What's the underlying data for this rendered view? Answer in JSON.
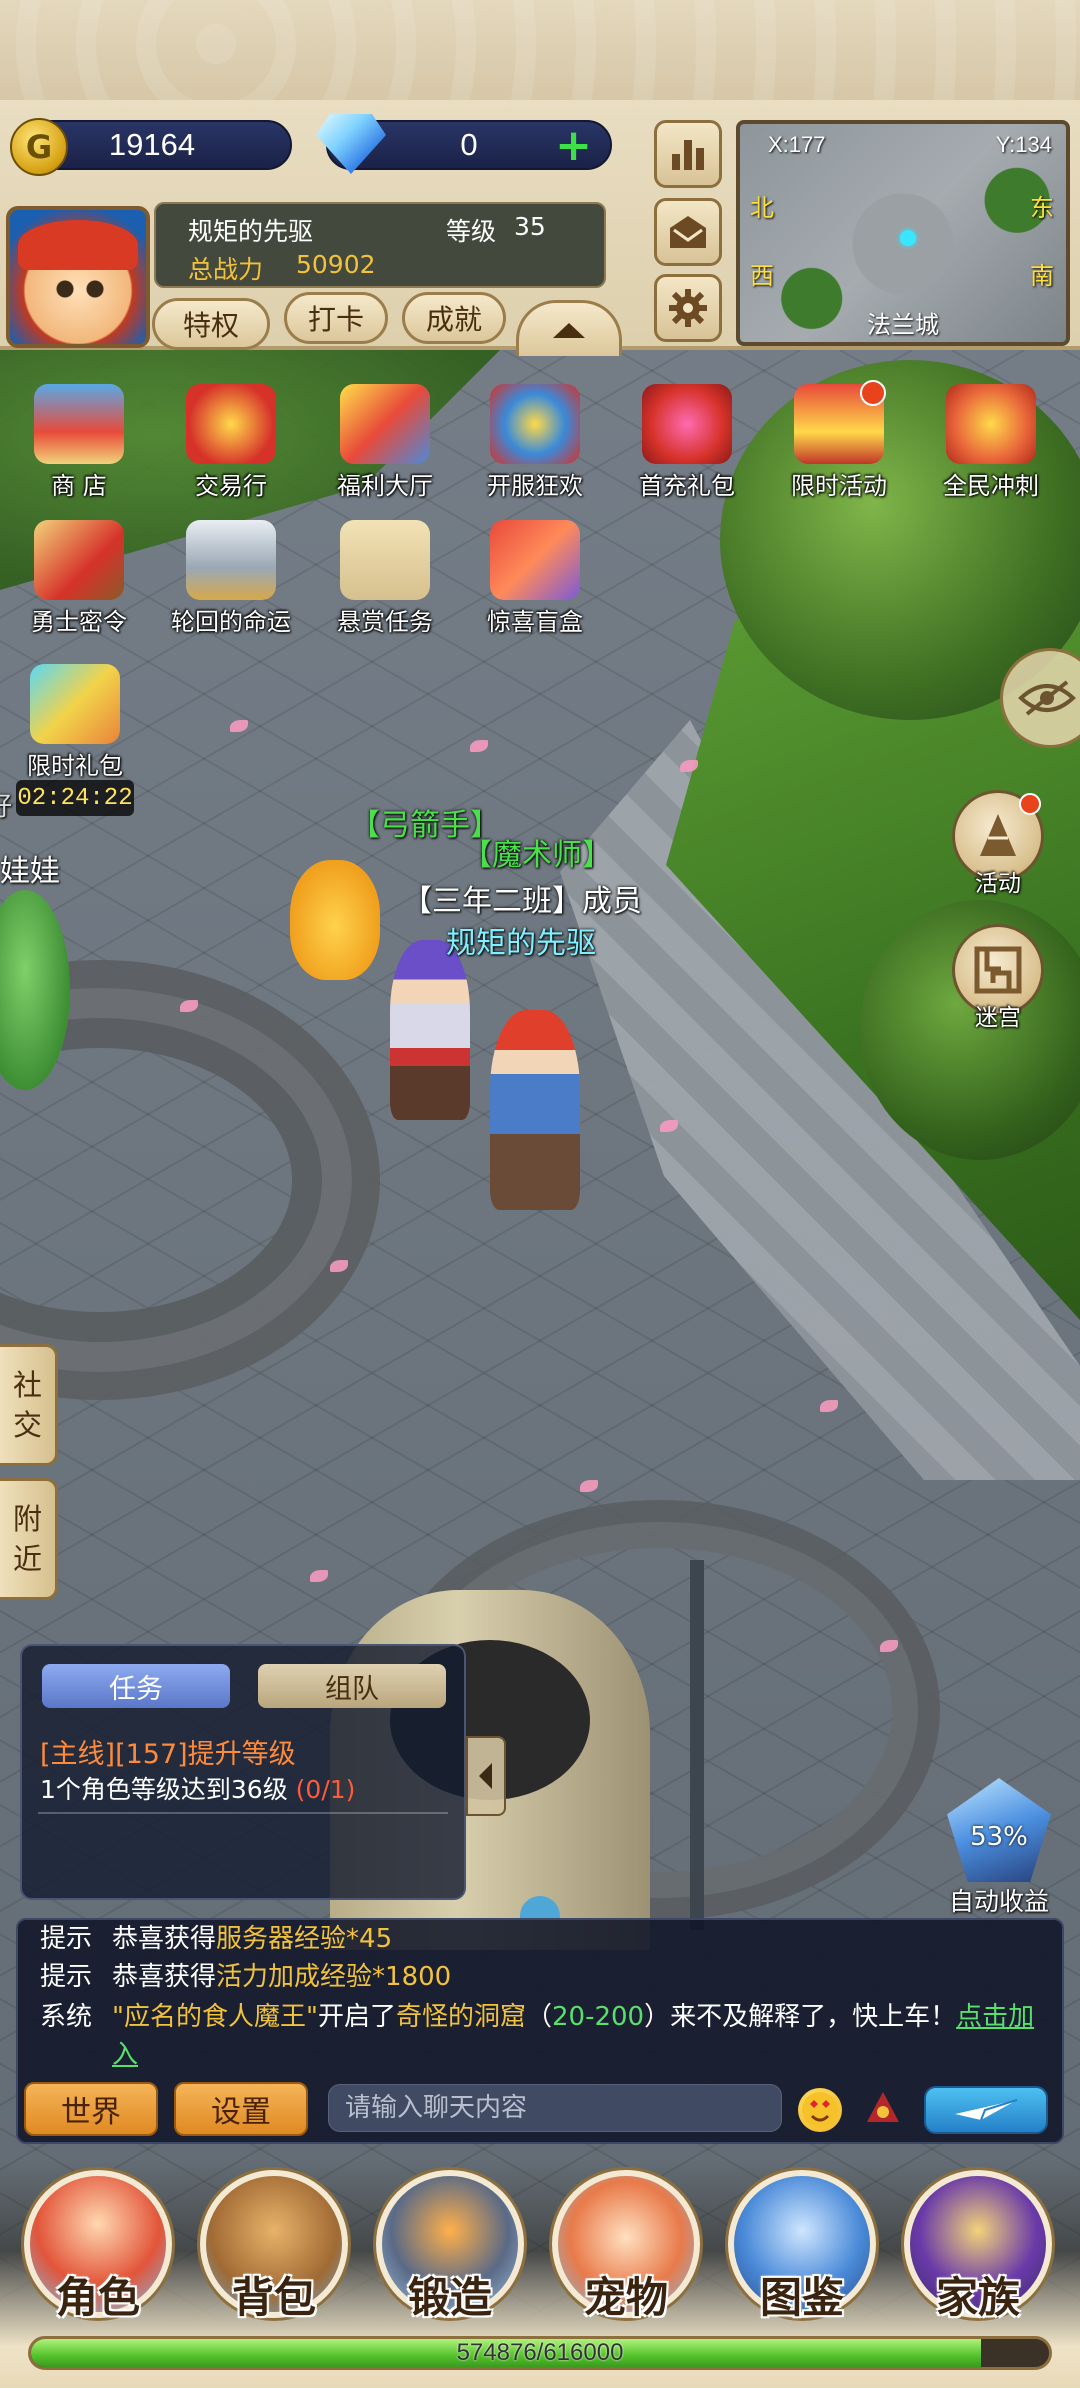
{
  "currency": {
    "gold": "19164",
    "diamond": "0"
  },
  "minimap": {
    "x_label": "X:177",
    "y_label": "Y:134",
    "north": "北",
    "east": "东",
    "west": "西",
    "south": "南",
    "city": "法兰城"
  },
  "player": {
    "name": "规矩的先驱",
    "level_label": "等级",
    "level": "35",
    "power_label": "总战力",
    "power": "50902"
  },
  "top_buttons": {
    "privilege": "特权",
    "checkin": "打卡",
    "achievement": "成就"
  },
  "activities": [
    {
      "label": "商 店",
      "icon": "shop-cart-icon",
      "badge": false
    },
    {
      "label": "交易行",
      "icon": "trade-scale-icon",
      "badge": false
    },
    {
      "label": "福利大厅",
      "icon": "welfare-gift-icon",
      "badge": false
    },
    {
      "label": "开服狂欢",
      "icon": "celebration-icon",
      "badge": false
    },
    {
      "label": "首充礼包",
      "icon": "first-recharge-icon",
      "badge": false
    },
    {
      "label": "限时活动",
      "icon": "limited-event-icon",
      "badge": true
    },
    {
      "label": "全民冲刺",
      "icon": "sprint-icon",
      "badge": false
    },
    {
      "label": "勇士密令",
      "icon": "warrior-order-icon",
      "badge": false
    },
    {
      "label": "轮回的命运",
      "icon": "fate-castle-icon",
      "badge": false
    },
    {
      "label": "悬赏任务",
      "icon": "wanted-poster-icon",
      "badge": false
    },
    {
      "label": "惊喜盲盒",
      "icon": "mystery-box-icon",
      "badge": false
    },
    {
      "label": "限时礼包",
      "icon": "limited-pack-icon",
      "badge": false
    }
  ],
  "timer": "02:24:22",
  "side_partial": {
    "line1": "好",
    "line2": "娃娃"
  },
  "right_buttons": {
    "event": "活动",
    "maze": "迷宫"
  },
  "side_tabs": {
    "social": [
      "社",
      "交"
    ],
    "nearby": [
      "附",
      "近"
    ]
  },
  "name_tags": {
    "pet_class": "【弓箭手】",
    "companion_class": "【魔术师】",
    "guild": "【三年二班】成员",
    "player": "规矩的先驱"
  },
  "quest": {
    "tab_task": "任务",
    "tab_team": "组队",
    "title": "[主线][157]提升等级",
    "desc": "1个角色等级达到36级",
    "progress": "(0/1)"
  },
  "auto": {
    "percent": "53%",
    "label": "自动收益"
  },
  "chat": {
    "lines": [
      {
        "kind": "提示",
        "parts": [
          "恭喜获得",
          "服务器经验*45"
        ]
      },
      {
        "kind": "提示",
        "parts": [
          "恭喜获得",
          "活力加成经验*1800"
        ]
      },
      {
        "kind": "系统",
        "parts": [
          "\"应名的食人魔王\"",
          "开启了",
          "奇怪的洞窟",
          "（",
          "20-200",
          "）来不及解释了，快上车！",
          "点击加",
          "入"
        ]
      }
    ],
    "world_btn": "世界",
    "settings_btn": "设置",
    "input_placeholder": "请输入聊天内容"
  },
  "bottom_nav": [
    {
      "label": "角色",
      "icon": "character-icon",
      "color": "#e2553a"
    },
    {
      "label": "背包",
      "icon": "backpack-icon",
      "color": "#a06a34"
    },
    {
      "label": "锻造",
      "icon": "anvil-hammer-icon",
      "color": "#5a6a86"
    },
    {
      "label": "宠物",
      "icon": "pet-icon",
      "color": "#e87a4a"
    },
    {
      "label": "图鉴",
      "icon": "book-icon",
      "color": "#4a8ad8"
    },
    {
      "label": "家族",
      "icon": "family-banner-icon",
      "color": "#6a3aa8"
    }
  ],
  "exp": {
    "text": "574876/616000",
    "fraction": 0.9333
  },
  "colors": {
    "accent_green": "#58e06a",
    "quest_orange": "#ff8a3a",
    "timer_yellow": "#ffe45a"
  }
}
